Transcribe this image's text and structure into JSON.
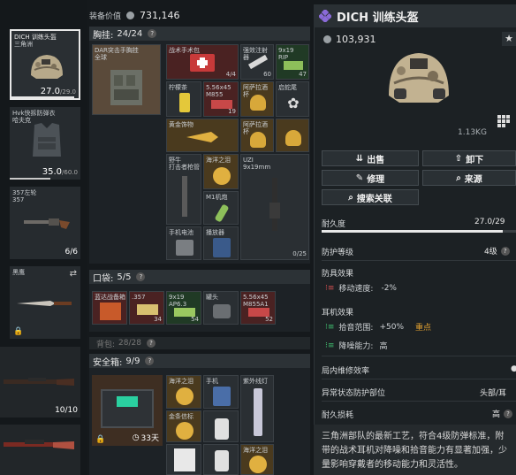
{
  "header": {
    "equipment_value_label": "装备价值",
    "equipment_value": "731,146"
  },
  "left_slots": [
    {
      "name": "DICH 训练头盔",
      "sub": "三角洲",
      "durability": "27.0",
      "durability_max": "/29.0"
    },
    {
      "name": "Hvk快拆防弹衣",
      "sub": "哈夫克",
      "durability": "35.0",
      "durability_max": "/60.0"
    },
    {
      "name": "357左轮",
      "sub": "357",
      "count": "6/6"
    },
    {
      "name": "黑鹰"
    },
    {
      "count": "10/10"
    },
    {
      "count": ""
    }
  ],
  "chest_rig": {
    "title": "胸挂:",
    "capacity": "24/24",
    "rig_name": "DAR突击手胸挂",
    "rig_sub": "全球",
    "items": [
      {
        "label": "战术手术包",
        "count": "4/4"
      },
      {
        "label": "强效注射器",
        "count": "60"
      },
      {
        "label": "9x19",
        "sub": "RIP",
        "count": "47"
      },
      {
        "label": "柠檬茶"
      },
      {
        "label": "5.56x45",
        "sub": "M855",
        "count": "19"
      },
      {
        "label": "阿萨拉酒杯"
      },
      {
        "label": "启蛇尾"
      },
      {
        "label": "黄金饰物"
      },
      {
        "label": "阿萨拉酒杯"
      },
      {
        "label": "野牛",
        "sub": "打击者枪管"
      },
      {
        "label": "海洋之泪"
      },
      {
        "label": "UZI",
        "sub": "9x19mm",
        "count": "0/25"
      },
      {
        "label": "M1机炮"
      },
      {
        "label": "手机电池"
      },
      {
        "label": "播放器"
      }
    ]
  },
  "pocket": {
    "title": "口袋:",
    "capacity": "5/5",
    "items": [
      {
        "label": "蓝达战备箱"
      },
      {
        "label": ".357",
        "count": "34"
      },
      {
        "label": "9x19",
        "sub": "AP6.3",
        "count": "54"
      },
      {
        "label": "罐头"
      },
      {
        "label": "5.56x45",
        "sub": "M855A1",
        "count": "52"
      }
    ]
  },
  "backpack": {
    "title": "背包:",
    "capacity": "28/28"
  },
  "safe_box": {
    "title": "安全箱:",
    "capacity": "9/9",
    "timer": "33天",
    "items": [
      {
        "label": "海洋之泪"
      },
      {
        "label": "手机"
      },
      {
        "label": "紫外线灯"
      },
      {
        "label": "金条信标"
      },
      {
        "label": ""
      },
      {
        "label": ""
      },
      {
        "label": ""
      },
      {
        "label": ""
      },
      {
        "label": "海洋之泪"
      }
    ]
  },
  "detail": {
    "title": "DICH 训练头盔",
    "price": "103,931",
    "weight": "1.13KG",
    "buttons": {
      "sell": "出售",
      "unequip": "卸下",
      "repair": "修理",
      "source": "来源",
      "search": "搜索关联"
    },
    "durability_label": "耐久度",
    "durability_value": "27.0/29",
    "protection_label": "防护等级",
    "protection_value": "4级",
    "effects_label": "防具效果",
    "move_speed_label": "移动速度:",
    "move_speed_value": "-2%",
    "ear_label": "耳机效果",
    "pickup_label": "拾音范围:",
    "pickup_value": "+50%",
    "pickup_tag": "重点",
    "noise_label": "降噪能力:",
    "noise_value": "高",
    "repair_eff_label": "局内维修效率",
    "abnormal_label": "异常状态防护部位",
    "abnormal_value": "头部/耳",
    "loss_label": "耐久损耗",
    "loss_value": "高",
    "description": "三角洲部队的最新工艺，符合4级防弹标准，附带的战术耳机对降噪和拾音能力有显著加强，少量影响穿戴者的移动能力和灵活性。",
    "accent": "#7b5cc4"
  }
}
